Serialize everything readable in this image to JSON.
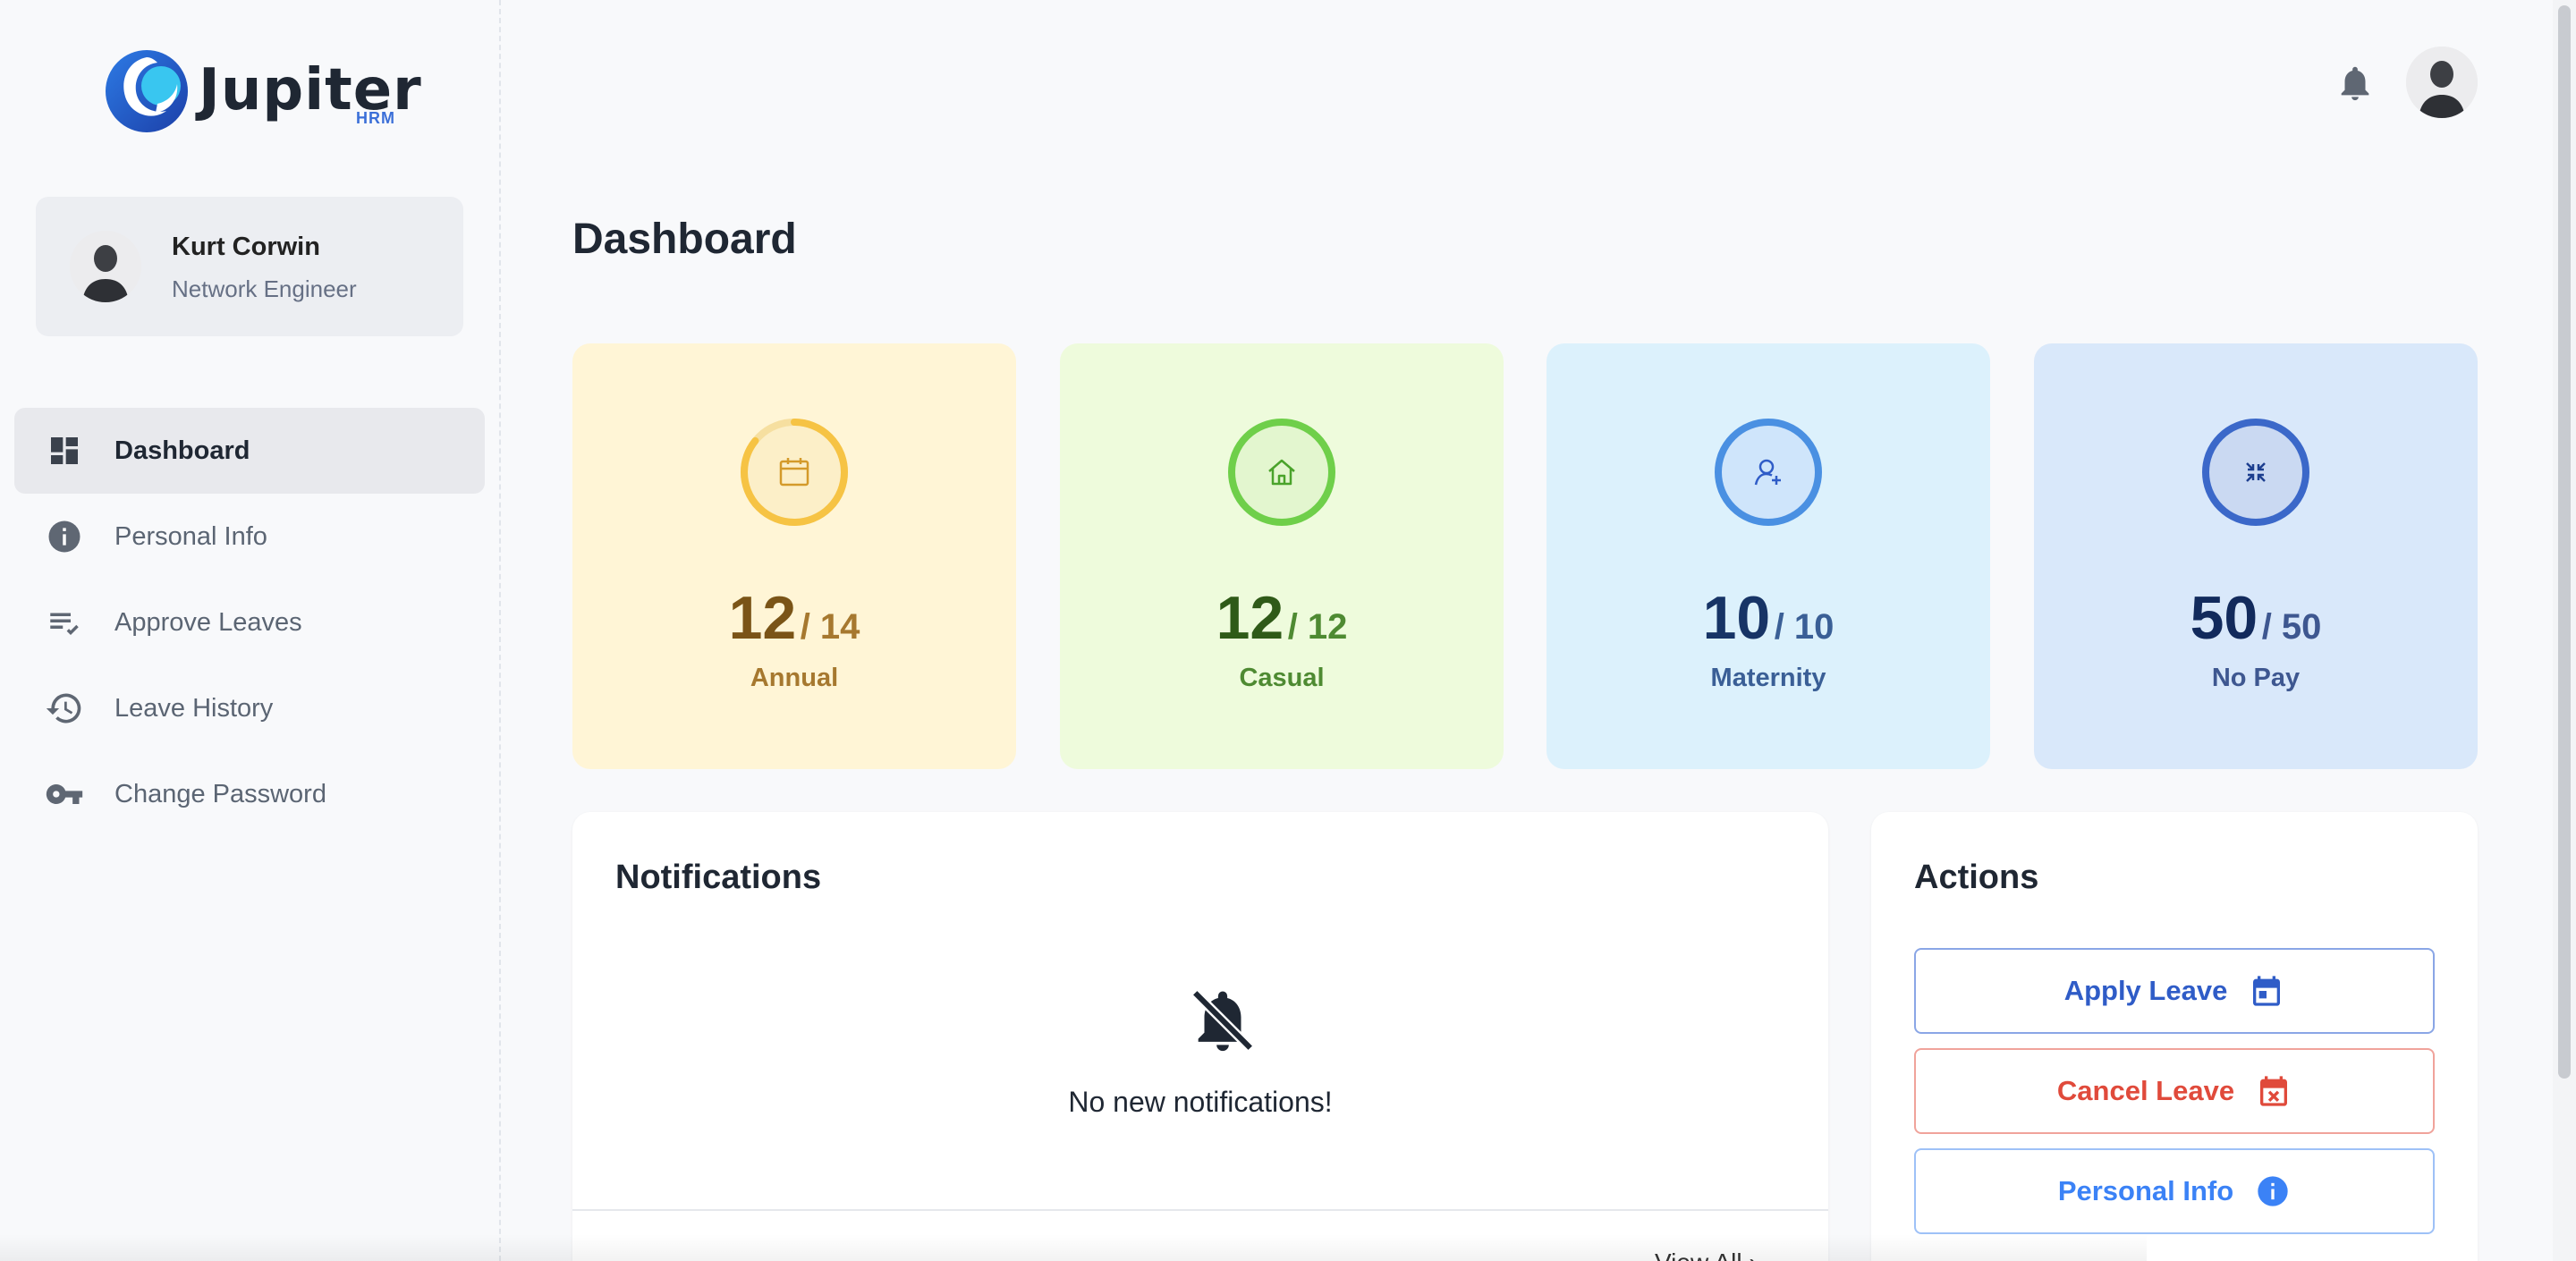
{
  "app": {
    "logo_text": "Jupiter",
    "logo_sub": "HRM"
  },
  "user": {
    "name": "Kurt Corwin",
    "role": "Network Engineer"
  },
  "sidebar": {
    "items": [
      {
        "label": "Dashboard",
        "icon": "dashboard-icon",
        "active": true
      },
      {
        "label": "Personal Info",
        "icon": "info-icon",
        "active": false
      },
      {
        "label": "Approve Leaves",
        "icon": "checklist-icon",
        "active": false
      },
      {
        "label": "Leave History",
        "icon": "history-icon",
        "active": false
      },
      {
        "label": "Change Password",
        "icon": "key-icon",
        "active": false
      }
    ]
  },
  "main": {
    "title": "Dashboard",
    "stats": [
      {
        "value": "12",
        "total": "/ 14",
        "label": "Annual",
        "icon": "calendar-icon",
        "fill": 0.857,
        "bg": "#fff5d6",
        "ring": "#f6c344",
        "text": "#7a5417",
        "sub": "#a6782f"
      },
      {
        "value": "12",
        "total": "/ 12",
        "label": "Casual",
        "icon": "home-icon",
        "fill": 1.0,
        "bg": "#eefbdc",
        "ring": "#6fcf4a",
        "text": "#2f5a18",
        "sub": "#4e8a32"
      },
      {
        "value": "10",
        "total": "/ 10",
        "label": "Maternity",
        "icon": "person-add-icon",
        "fill": 1.0,
        "bg": "#dcf1fc",
        "ring": "#4a90e2",
        "text": "#173466",
        "sub": "#3a5f96"
      },
      {
        "value": "50",
        "total": "/ 50",
        "label": "No Pay",
        "icon": "collapse-icon",
        "fill": 1.0,
        "bg": "#d9e8fa",
        "ring": "#3b68c9",
        "text": "#122a5c",
        "sub": "#3e5790"
      }
    ],
    "notifications": {
      "title": "Notifications",
      "empty_text": "No new notifications!",
      "view_all": "View All"
    },
    "actions": {
      "title": "Actions",
      "buttons": [
        {
          "label": "Apply Leave",
          "icon": "calendar-icon",
          "color": "#2f5cc7",
          "border": "#8aa6e6"
        },
        {
          "label": "Cancel Leave",
          "icon": "calendar-x-icon",
          "color": "#e04a3b",
          "border": "#f0a39b"
        },
        {
          "label": "Personal Info",
          "icon": "info-icon",
          "color": "#3b82f6",
          "border": "#9ec1f7"
        }
      ]
    }
  }
}
